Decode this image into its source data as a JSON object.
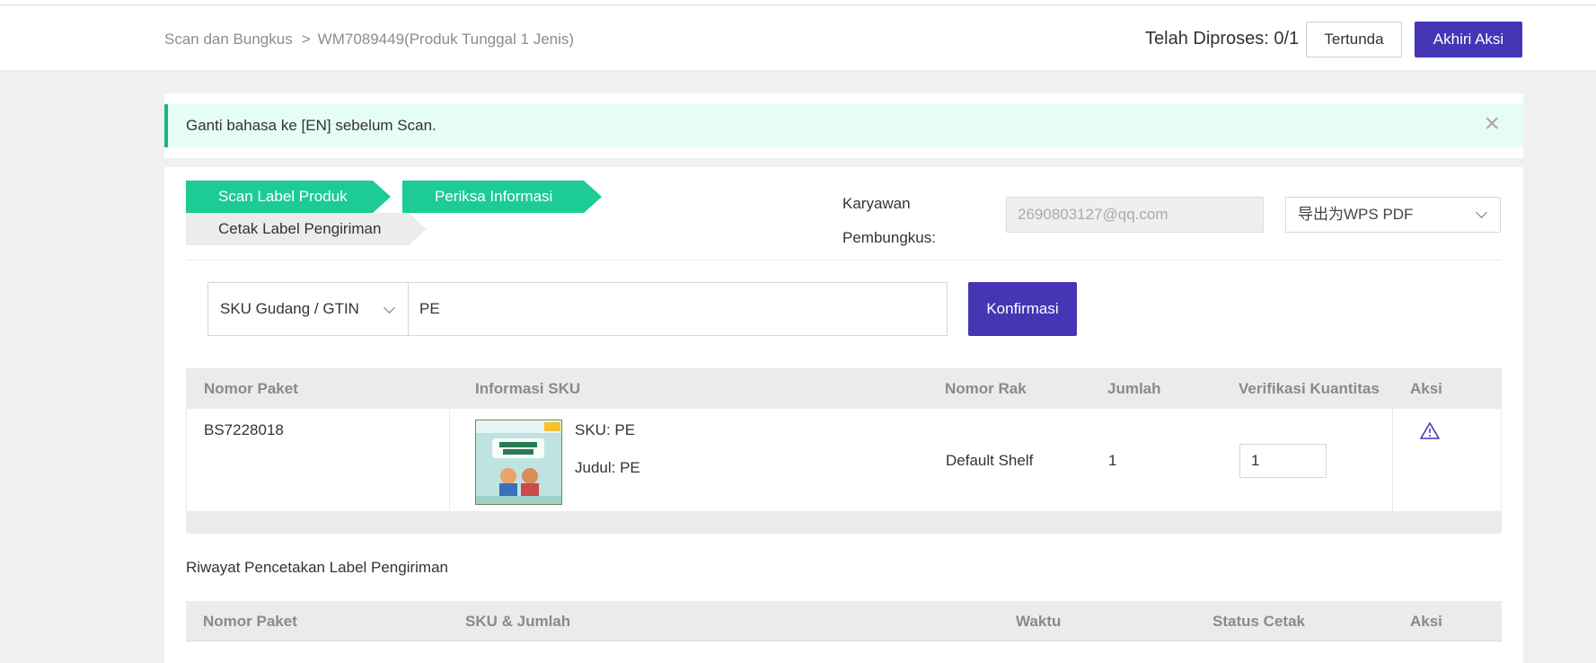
{
  "header": {
    "breadcrumb_root": "Scan dan Bungkus",
    "breadcrumb_separator": ">",
    "breadcrumb_current": "WM7089449(Produk Tunggal 1 Jenis)",
    "processed_label": "Telah Diproses: 0/1",
    "pending_button": "Tertunda",
    "end_button": "Akhiri Aksi"
  },
  "alert": {
    "text": "Ganti bahasa ke [EN] sebelum Scan.",
    "close": "×"
  },
  "steps": [
    {
      "label": "Scan Label Produk",
      "state": "active"
    },
    {
      "label": "Periksa Informasi",
      "state": "active"
    },
    {
      "label": "Cetak Label Pengiriman",
      "state": "inactive"
    }
  ],
  "packer": {
    "label_line1": "Karyawan",
    "label_line2": "Pembungkus:",
    "email": "2690803127@qq.com"
  },
  "export_select": {
    "value": "导出为WPS PDF"
  },
  "scan": {
    "type_value": "SKU Gudang / GTIN",
    "input_value": "PE",
    "confirm_button": "Konfirmasi"
  },
  "package_table": {
    "headers": [
      "Nomor Paket",
      "Informasi SKU",
      "Nomor Rak",
      "Jumlah",
      "Verifikasi Kuantitas",
      "Aksi"
    ],
    "rows": [
      {
        "package_no": "BS7228018",
        "sku": "SKU: PE",
        "title": "Judul: PE",
        "shelf": "Default Shelf",
        "quantity": "1",
        "verify_qty": "1"
      }
    ]
  },
  "history": {
    "title": "Riwayat Pencetakan Label Pengiriman",
    "headers": [
      "Nomor Paket",
      "SKU & Jumlah",
      "Waktu",
      "Status Cetak",
      "Aksi"
    ]
  },
  "colors": {
    "primary": "#4436b5",
    "step_active": "#1ccb95",
    "alert_bg": "#e6fcf6",
    "alert_border": "#15b886"
  },
  "icons": {
    "alert_close": "close-icon",
    "row_action": "warning-icon",
    "select_arrow": "chevron-down-icon"
  }
}
